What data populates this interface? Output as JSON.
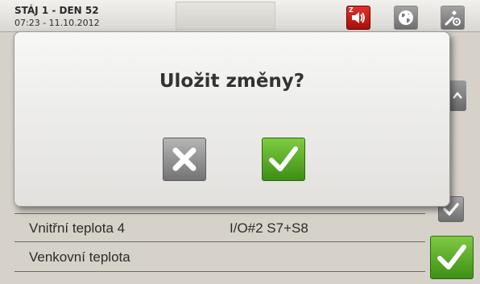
{
  "header": {
    "title": "STÁJ 1 - DEN 52",
    "datetime": "07:23 - 11.10.2012",
    "sound_badge": "Z",
    "buttons": [
      {
        "icon": "speaker-icon",
        "color": "#c61d18"
      },
      {
        "icon": "globe-icon",
        "color": "#858585"
      },
      {
        "icon": "tools-icon",
        "color": "#858585"
      }
    ]
  },
  "background_rows": [
    {
      "label": "Vnitřní teplota 4",
      "value": "I/O#2 S7+S8"
    },
    {
      "label": "Venkovní teplota",
      "value": ""
    }
  ],
  "dialog": {
    "title": "Uložit změny?",
    "cancel_icon": "close-icon",
    "confirm_icon": "check-icon",
    "confirm_color": "#5aab2c",
    "cancel_color": "#8f8f8f"
  }
}
